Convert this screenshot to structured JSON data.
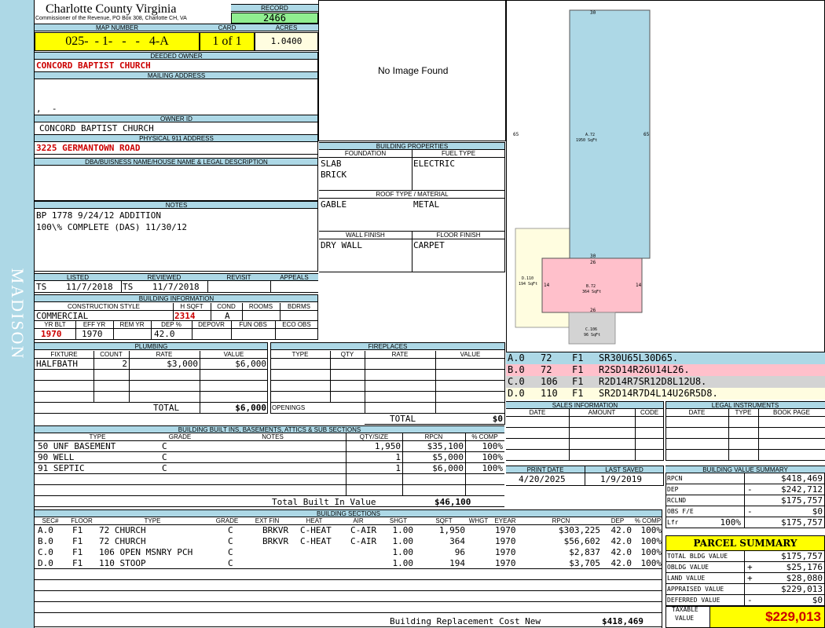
{
  "side_label": "MADISON",
  "county": {
    "title": "Charlotte County Virginia",
    "subtitle": "Commissioner of the Revenue, PO Box 308, Charlotte CH, VA"
  },
  "record": {
    "label": "RECORD",
    "value": "2466"
  },
  "map": {
    "label": "MAP NUMBER",
    "value": "025-  - 1-   -   -   4-A"
  },
  "card": {
    "label": "CARD",
    "value": "1 of 1"
  },
  "acres": {
    "label": "ACRES",
    "value": "1.0400"
  },
  "deeded_owner": {
    "label": "DEEDED OWNER",
    "value": "CONCORD BAPTIST CHURCH"
  },
  "mailing": {
    "label": "MAILING ADDRESS",
    "value": ",  -"
  },
  "owner_id": {
    "label": "OWNER ID",
    "value": "CONCORD BAPTIST CHURCH"
  },
  "physical": {
    "label": "PHYSICAL 911 ADDRESS",
    "value": "3225 GERMANTOWN ROAD"
  },
  "dba": {
    "label": "DBA/BUISNESS NAME/HOUSE NAME & LEGAL DESCRIPTION"
  },
  "notes": {
    "label": "NOTES",
    "line1": "BP 1778 9/24/12 ADDITION",
    "line2": "100\\% COMPLETE (DAS) 11/30/12"
  },
  "image_msg": "No Image Found",
  "listing": {
    "listed_label": "LISTED",
    "reviewed_label": "REVIEWED",
    "revisit_label": "REVISIT",
    "appeals_label": "APPEALS",
    "listed_by": "TS",
    "listed_date": "11/7/2018",
    "reviewed_by": "TS",
    "reviewed_date": "11/7/2018"
  },
  "bldg_info": {
    "label": "BUILDING INFORMATION",
    "style_label": "CONSTRUCTION STYLE",
    "hsqft_label": "H SQFT",
    "cond_label": "COND",
    "rooms_label": "ROOMS",
    "bdrms_label": "BDRMS",
    "style": "COMMERCIAL",
    "hsqft": "2314",
    "cond": "A",
    "yrblt_label": "YR BLT",
    "effyr_label": "EFF YR",
    "remyr_label": "REM YR",
    "dep_label": "DEP %",
    "depovr_label": "DEPOVR",
    "funobs_label": "FUN OBS",
    "ecoobs_label": "ECO OBS",
    "yrblt": "1970",
    "effyr": "1970",
    "dep": "42.0"
  },
  "props": {
    "label": "BUILDING PROPERTIES",
    "foundation_label": "FOUNDATION",
    "fuel_label": "FUEL TYPE",
    "foundation1": "SLAB",
    "foundation2": "BRICK",
    "fuel": "ELECTRIC",
    "roof_label": "ROOF TYPE / MATERIAL",
    "roof_type": "GABLE",
    "roof_mat": "METAL",
    "wall_label": "WALL FINISH",
    "floor_label": "FLOOR FINISH",
    "wall": "DRY WALL",
    "floor": "CARPET"
  },
  "plumbing": {
    "label": "PLUMBING",
    "cols": [
      "FIXTURE",
      "COUNT",
      "RATE",
      "VALUE"
    ],
    "rows": [
      {
        "fixture": "HALFBATH",
        "count": "2",
        "rate": "$3,000",
        "value": "$6,000"
      }
    ],
    "total_label": "TOTAL",
    "total": "$6,000"
  },
  "fireplaces": {
    "label": "FIREPLACES",
    "cols": [
      "TYPE",
      "QTY",
      "RATE",
      "VALUE"
    ],
    "openings_label": "OPENINGS",
    "total_label": "TOTAL",
    "total": "$0"
  },
  "builtins": {
    "label": "BUILDING BUILT INS, BASEMENTS, ATTICS & SUB SECTIONS",
    "cols": [
      "TYPE",
      "GRADE",
      "NOTES",
      "QTY/SIZE",
      "RPCN",
      "% COMP"
    ],
    "rows": [
      {
        "type": "50 UNF BASEMENT",
        "grade": "C",
        "qty": "1,950",
        "rpcn": "$35,100",
        "comp": "100%"
      },
      {
        "type": "90 WELL",
        "grade": "C",
        "qty": "1",
        "rpcn": "$5,000",
        "comp": "100%"
      },
      {
        "type": "91 SEPTIC",
        "grade": "C",
        "qty": "1",
        "rpcn": "$6,000",
        "comp": "100%"
      }
    ],
    "total_label": "Total Built In Value",
    "total": "$46,100"
  },
  "sections": {
    "label": "BUILDING SECTIONS",
    "cols": [
      "SEC#",
      "FLOOR",
      "TYPE",
      "GRADE",
      "EXT FIN",
      "HEAT",
      "AIR",
      "SHGT",
      "SQFT",
      "WHGT",
      "EYEAR",
      "RPCN",
      "DEP",
      "% COMP"
    ],
    "rows": [
      {
        "sec": "A.0",
        "floor": "F1",
        "type": "72 CHURCH",
        "grade": "C",
        "ext": "BRKVR",
        "heat": "C-HEAT",
        "air": "C-AIR",
        "shgt": "1.00",
        "sqft": "1,950",
        "eyear": "1970",
        "rpcn": "$303,225",
        "dep": "42.0",
        "comp": "100%"
      },
      {
        "sec": "B.0",
        "floor": "F1",
        "type": "72 CHURCH",
        "grade": "C",
        "ext": "BRKVR",
        "heat": "C-HEAT",
        "air": "C-AIR",
        "shgt": "1.00",
        "sqft": "364",
        "eyear": "1970",
        "rpcn": "$56,602",
        "dep": "42.0",
        "comp": "100%"
      },
      {
        "sec": "C.0",
        "floor": "F1",
        "type": "106 OPEN MSNRY PCH",
        "grade": "C",
        "ext": "",
        "heat": "",
        "air": "",
        "shgt": "1.00",
        "sqft": "96",
        "eyear": "1970",
        "rpcn": "$2,837",
        "dep": "42.0",
        "comp": "100%"
      },
      {
        "sec": "D.0",
        "floor": "F1",
        "type": "110 STOOP",
        "grade": "C",
        "ext": "",
        "heat": "",
        "air": "",
        "shgt": "1.00",
        "sqft": "194",
        "eyear": "1970",
        "rpcn": "$3,705",
        "dep": "42.0",
        "comp": "100%"
      }
    ],
    "total_label": "Building Replacement Cost New",
    "total": "$418,469"
  },
  "sketch": {
    "a": {
      "label": "A.72",
      "sqft": "1950 SqFt",
      "top": "30",
      "bottom": "30",
      "left": "65",
      "right": "65"
    },
    "b": {
      "label": "B.72",
      "sqft": "364 SqFt",
      "top": "26",
      "bottom": "26",
      "left": "14",
      "right": "14"
    },
    "c": {
      "label": "C.106",
      "sqft": "96 SqFt"
    },
    "d": {
      "label": "D.110",
      "sqft": "194 SqFt"
    }
  },
  "legend": [
    {
      "code": "A.0",
      "num": "72",
      "floor": "F1",
      "desc": "SR30U65L30D65.",
      "color": "#add8e6"
    },
    {
      "code": "B.0",
      "num": "72",
      "floor": "F1",
      "desc": "R2SD14R26U14L26.",
      "color": "#ffc0cb"
    },
    {
      "code": "C.0",
      "num": "106",
      "floor": "F1",
      "desc": "R2D14R7SR12D8L12U8.",
      "color": "#d3d3d3"
    },
    {
      "code": "D.0",
      "num": "110",
      "floor": "F1",
      "desc": "SR2D14R7D4L14U26R5D8.",
      "color": "#fffde0"
    }
  ],
  "sales": {
    "label": "SALES INFORMATION",
    "cols": [
      "DATE",
      "AMOUNT",
      "CODE"
    ]
  },
  "legal": {
    "label": "LEGAL INSTRUMENTS",
    "cols": [
      "DATE",
      "TYPE",
      "BOOK PAGE"
    ]
  },
  "print": {
    "print_label": "PRINT DATE",
    "saved_label": "LAST SAVED",
    "print_date": "4/20/2025",
    "saved_date": "1/9/2019"
  },
  "bvs": {
    "label": "BUILDING VALUE SUMMARY",
    "rows": [
      {
        "label": "RPCN",
        "sign": "",
        "value": "$418,469"
      },
      {
        "label": "DEP",
        "sign": "-",
        "value": "$242,712"
      },
      {
        "label": "RCLND",
        "sign": "",
        "value": "$175,757"
      },
      {
        "label": "OBS F/E",
        "sign": "-",
        "value": "$0"
      },
      {
        "label": "Lfr",
        "pct": "100%",
        "sign": "",
        "value": "$175,757"
      }
    ]
  },
  "parcel": {
    "label": "PARCEL SUMMARY",
    "rows": [
      {
        "label": "TOTAL BLDG VALUE",
        "sign": "",
        "value": "$175,757"
      },
      {
        "label": "OBLDG VALUE",
        "sign": "+",
        "value": "$25,176"
      },
      {
        "label": "LAND VALUE",
        "sign": "+",
        "value": "$28,080"
      },
      {
        "label": "APPRAISED VALUE",
        "sign": "",
        "value": "$229,013"
      },
      {
        "label": "DEFERRED VALUE",
        "sign": "-",
        "value": "$0"
      }
    ],
    "taxable_label1": "TAXABLE",
    "taxable_label2": "VALUE",
    "taxable": "$229,013"
  },
  "colors": {
    "header": "#add8e6",
    "record": "#90ee90",
    "yellow": "#ffff00",
    "acres": "#fffde0",
    "red": "#cc0000"
  }
}
